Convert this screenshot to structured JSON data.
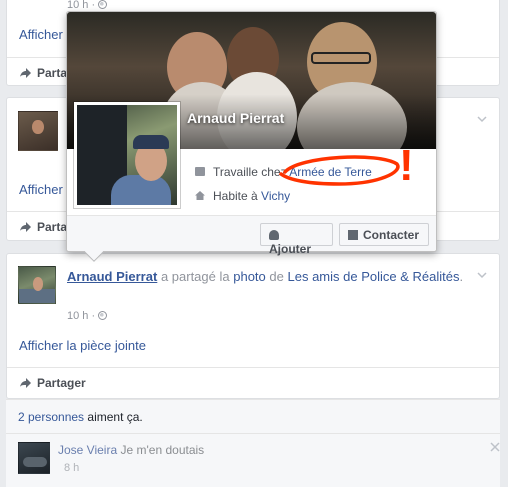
{
  "post_top": {
    "time": "10 h ·",
    "attachment_link": "Afficher",
    "share_label": "Partag"
  },
  "post_mid": {
    "attachment_link": "Afficher",
    "share_label": "Partag"
  },
  "post_main": {
    "author": "Arnaud Pierrat",
    "verb": "a partagé la",
    "photo_link": "photo",
    "of": "de",
    "page_link": "Les amis de Police & Réalités",
    "dot": ".",
    "time": "10 h ·",
    "attachment_link": "Afficher la pièce jointe",
    "share_label": "Partager"
  },
  "likes": {
    "count_link": "2 personnes",
    "text": "aiment ça."
  },
  "comment": {
    "author": "Jose Vieira",
    "text": "Je m'en doutais",
    "time": "8 h"
  },
  "hovercard": {
    "name": "Arnaud Pierrat",
    "work_prefix": "Travaille chez",
    "work_link": "Armée de Terre",
    "home_prefix": "Habite à",
    "home_link": "Vichy",
    "add_button": "Ajouter",
    "contact_button": "Contacter",
    "annotation": "!"
  },
  "colors": {
    "link": "#365899",
    "annotation": "#ff3300",
    "background": "#e9ebee"
  },
  "icons": [
    "briefcase-icon",
    "home-icon",
    "add-friend-icon",
    "message-icon",
    "share-icon",
    "globe-icon",
    "chevron-down-icon",
    "close-icon"
  ]
}
